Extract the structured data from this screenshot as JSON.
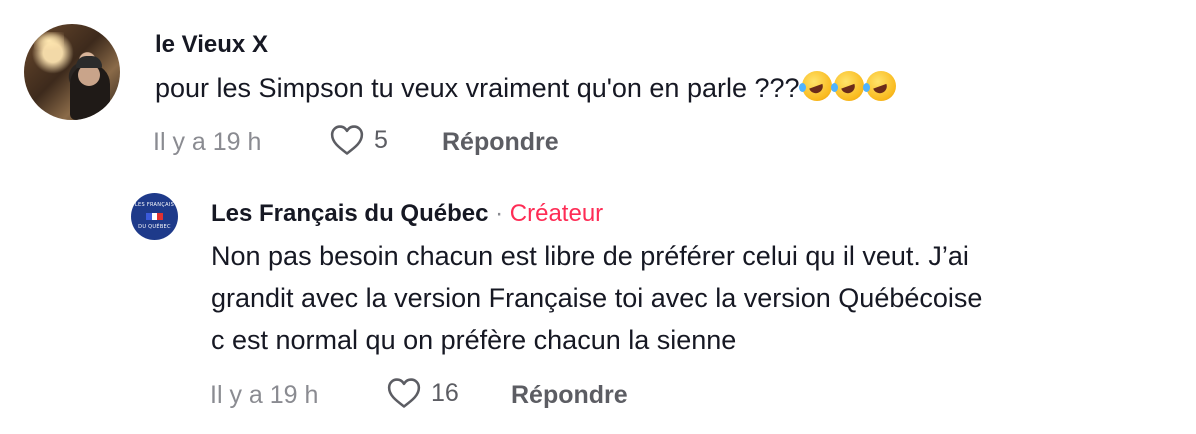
{
  "comments": [
    {
      "username": "le Vieux X",
      "text": "pour les Simpson tu veux vraiment qu'on en parle ???",
      "emojis": [
        "rolling-on-floor-laughing",
        "rolling-on-floor-laughing",
        "rolling-on-floor-laughing"
      ],
      "time": "Il y a 19 h",
      "likes": "5",
      "reply_label": "Répondre"
    }
  ],
  "replies": [
    {
      "username": "Les Français du Québec",
      "separator": "·",
      "badge": "Créateur",
      "badge_color": "#fe2c55",
      "lines": [
        "Non pas besoin chacun est libre de préférer celui qu il veut. J’ai",
        "grandit avec la version Française toi avec la version Québécoise",
        "c est normal qu on préfère chacun la sienne"
      ],
      "time": "Il y a 19 h",
      "likes": "16",
      "reply_label": "Répondre",
      "avatar_logo": {
        "top_text": "LES FRANÇAIS",
        "bottom_text": "DU QUÉBEC",
        "bg_color": "#1e3a8a"
      }
    }
  ],
  "icons": {
    "like": "heart-outline-icon"
  },
  "colors": {
    "text": "#161823",
    "meta": "#8a8b91",
    "action": "#5c5d63"
  }
}
